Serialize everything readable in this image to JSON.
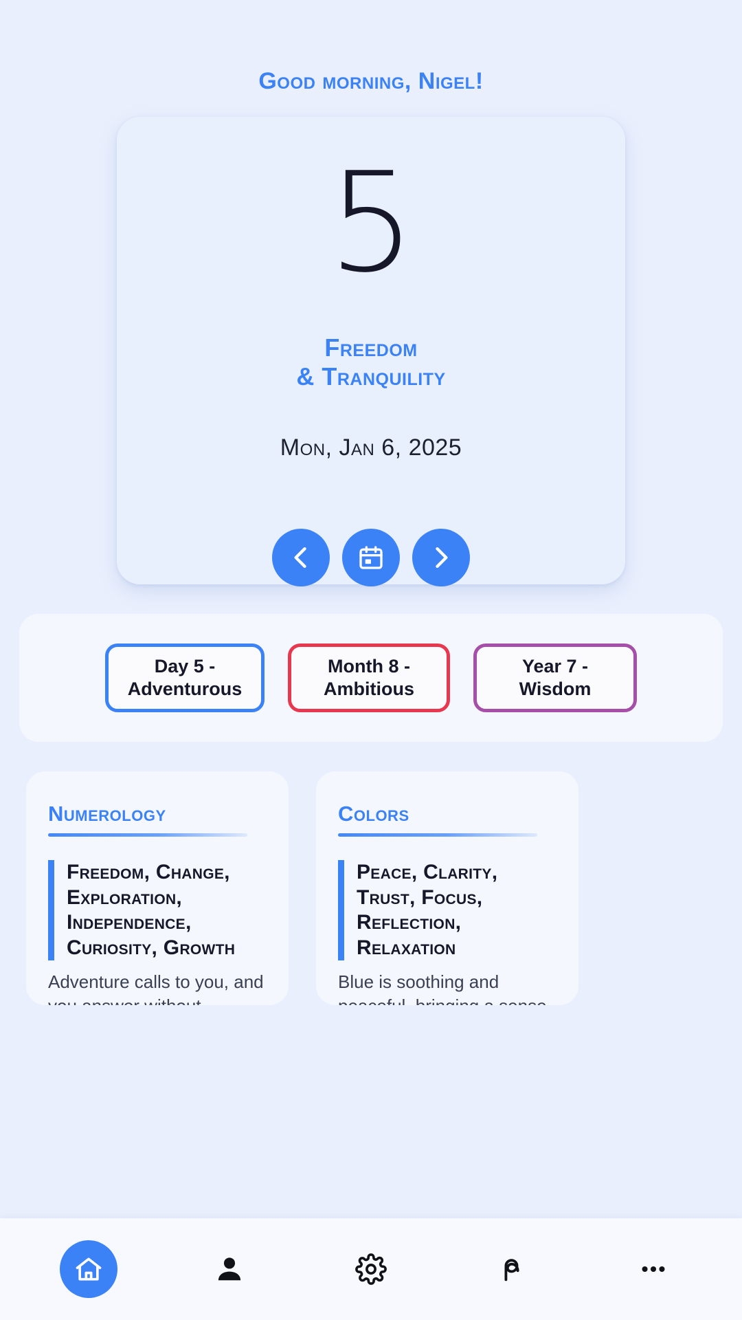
{
  "greeting": "Good morning, Nigel!",
  "hero": {
    "number": "5",
    "meaning_line1": "Freedom",
    "meaning_line2": "& Tranquility",
    "date": "Mon, Jan 6, 2025",
    "nav": {
      "prev_icon": "chevron-left-icon",
      "calendar_icon": "calendar-icon",
      "next_icon": "chevron-right-icon"
    }
  },
  "badges": [
    {
      "label_line1": "Day 5 -",
      "label_line2": "Adventurous",
      "color": "#3b82f6"
    },
    {
      "label_line1": "Month 8 -",
      "label_line2": "Ambitious",
      "color": "#e8384f"
    },
    {
      "label_line1": "Year 7 - Wisdom",
      "label_line2": "",
      "color": "#a54fa8"
    }
  ],
  "info_cards": [
    {
      "title": "Numerology",
      "keywords": "Freedom, Change, Exploration, Independence, Curiosity, Growth",
      "body": "Adventure calls to you, and you answer without hesitation. Life is meant to"
    },
    {
      "title": "Colors",
      "keywords": "Peace, Clarity, Trust, Focus, Reflection, Relaxation",
      "body": "Blue is soothing and peaceful, bringing a sense of calm and clarity. It helps"
    }
  ],
  "bottom_nav": [
    {
      "name": "home-icon",
      "active": true
    },
    {
      "name": "person-icon",
      "active": false
    },
    {
      "name": "gear-icon",
      "active": false
    },
    {
      "name": "numerology-glyph-icon",
      "active": false
    },
    {
      "name": "more-icon",
      "active": false
    }
  ],
  "colors": {
    "accent": "#3b82f6",
    "background": "#e9effd",
    "card": "#f4f7fe",
    "text_dark": "#16182a"
  }
}
